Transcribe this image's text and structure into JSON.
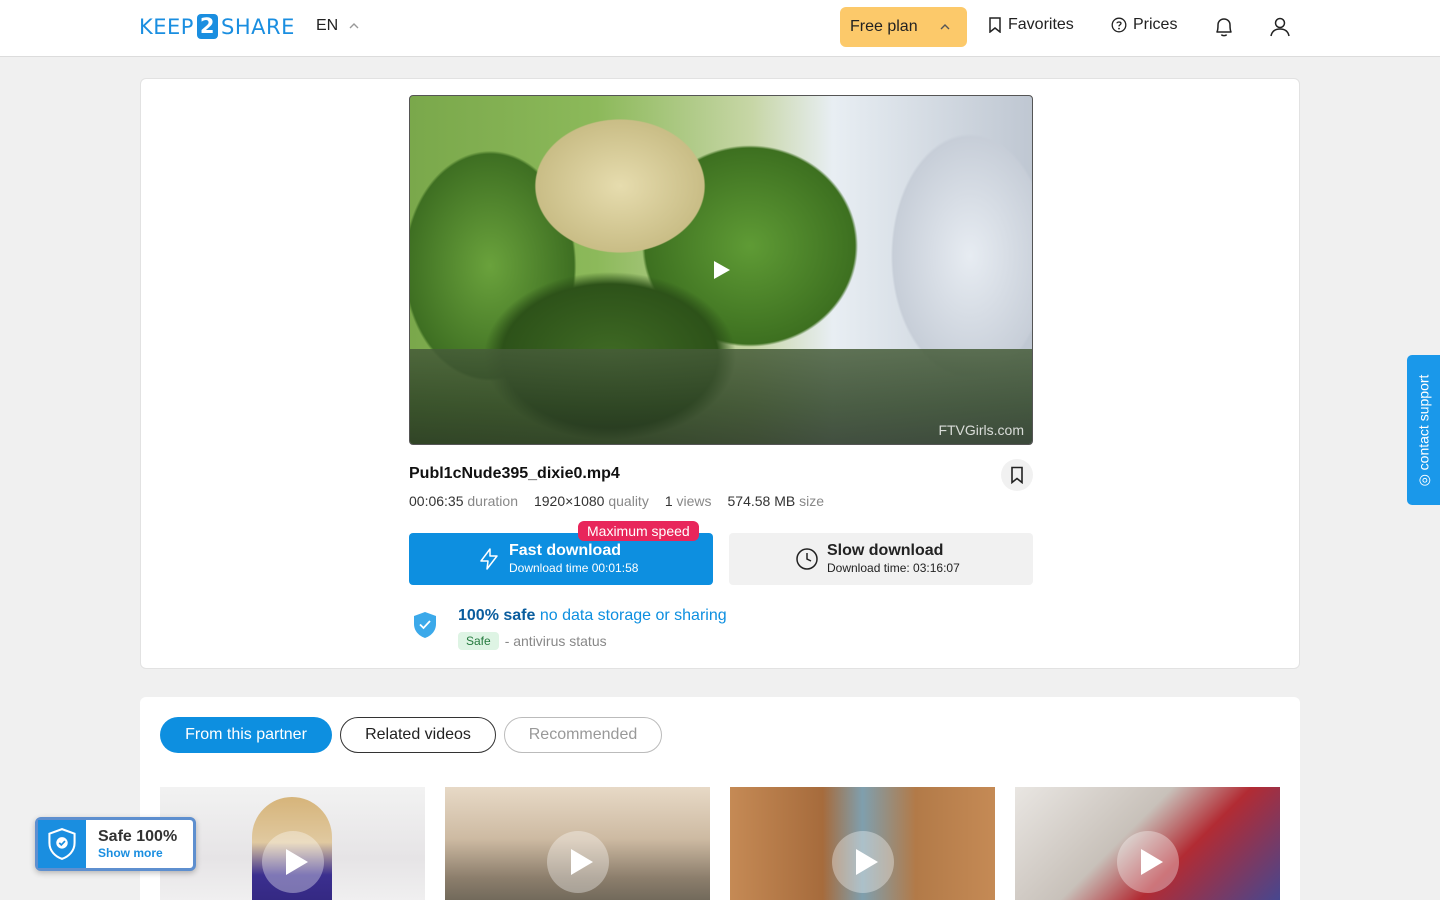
{
  "header": {
    "logo_pre": "KEEP",
    "logo_num": "2",
    "logo_post": "SHARE",
    "lang": "EN",
    "plan": "Free plan",
    "favorites": "Favorites",
    "prices": "Prices"
  },
  "file": {
    "name": "Publ1cNude395_dixie0.mp4",
    "watermark": "FTVGirls.com",
    "duration_value": "00:06:35",
    "duration_unit": "duration",
    "quality_value": "1920×1080",
    "quality_unit": "quality",
    "views_value": "1",
    "views_unit": "views",
    "size_value": "574.58 MB",
    "size_unit": "size"
  },
  "download": {
    "badge": "Maximum speed",
    "fast_title": "Fast download",
    "fast_sub": "Download time 00:01:58",
    "slow_title": "Slow download",
    "slow_sub": "Download time: 03:16:07"
  },
  "safety": {
    "bold": "100% safe",
    "rest": "no data storage or sharing",
    "chip": "Safe",
    "status": "- antivirus status"
  },
  "tabs": [
    "From this partner",
    "Related videos",
    "Recommended"
  ],
  "support": "contact support",
  "safe_widget": {
    "title": "Safe 100%",
    "more": "Show more"
  },
  "colors": {
    "accent": "#0d8fe0",
    "plan": "#fcc96a",
    "badge": "#e8265b"
  }
}
